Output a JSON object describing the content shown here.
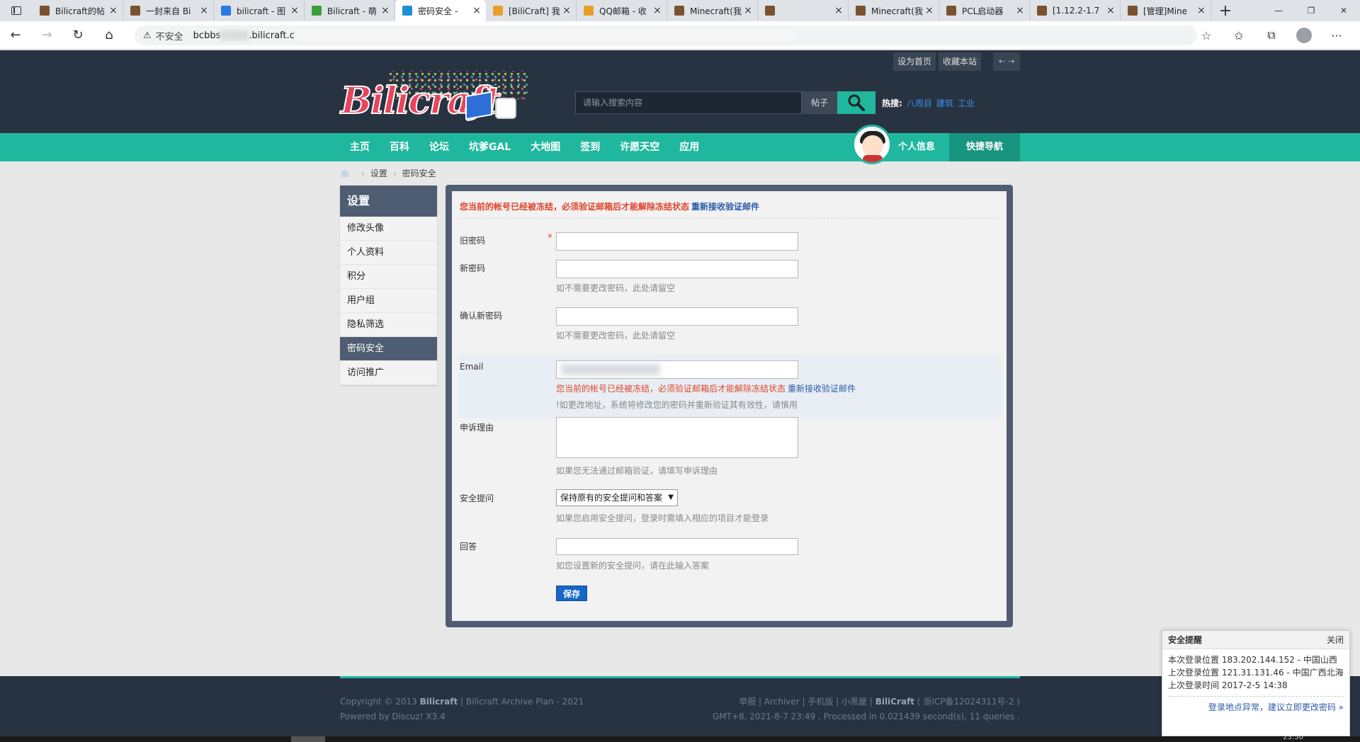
{
  "browser": {
    "tabs": [
      {
        "title": "Bilicraft的帖",
        "color": "#7a5230",
        "active": false
      },
      {
        "title": "一封来自 Bi",
        "color": "#7a5230",
        "active": false
      },
      {
        "title": "bilicraft - 图",
        "color": "#2a7ae2",
        "active": false
      },
      {
        "title": "Bilicraft - 萌",
        "color": "#3aa03a",
        "active": false
      },
      {
        "title": "密码安全 -",
        "color": "#1e8fd6",
        "active": true
      },
      {
        "title": "[BiliCraft] 我",
        "color": "#e6a02a",
        "active": false
      },
      {
        "title": "QQ邮箱 - 收",
        "color": "#e6a02a",
        "active": false
      },
      {
        "title": "Minecraft(我",
        "color": "#7a5230",
        "active": false
      },
      {
        "title": "",
        "color": "#7a5230",
        "active": false
      },
      {
        "title": "Minecraft(我",
        "color": "#7a5230",
        "active": false
      },
      {
        "title": "PCL启动器",
        "color": "#7a5230",
        "active": false
      },
      {
        "title": "[1.12.2-1.7",
        "color": "#7a5230",
        "active": false
      },
      {
        "title": "[管理]Mine",
        "color": "#7a5230",
        "active": false
      }
    ],
    "new_tab": "+",
    "win": {
      "min": "—",
      "max": "❐",
      "close": "✕"
    },
    "nav": {
      "back": "←",
      "forward": "→",
      "reload": "↻",
      "home": "⌂"
    },
    "url": {
      "warn_icon": "⚠",
      "insecure": "不安全",
      "text": "bcbbs",
      "text2": ".bilicraft.c"
    },
    "addr_icons": {
      "fav": "☆",
      "favorites": "✩",
      "collections": "⧉",
      "more": "···"
    }
  },
  "site": {
    "top_links": [
      "设为首页",
      "收藏本站"
    ],
    "top_arrows": "⇠ ⇢",
    "logo": "Bilicraft",
    "search": {
      "placeholder": "请输入搜索内容",
      "type": "帖子"
    },
    "hot": {
      "label": "热搜:",
      "items": [
        "八周目",
        "建筑",
        "工业"
      ]
    },
    "nav": [
      "主页",
      "百科",
      "论坛",
      "坑爹GAL",
      "大地图",
      "签到",
      "许愿天空",
      "应用"
    ],
    "me": "个人信息",
    "quick_nav": "快捷导航"
  },
  "breadcrumb": {
    "items": [
      "设置",
      "密码安全"
    ],
    "sep": "›"
  },
  "sidebar": {
    "title": "设置",
    "items": [
      "修改头像",
      "个人资料",
      "积分",
      "用户组",
      "隐私筛选",
      "密码安全",
      "访问推广"
    ],
    "active_index": 5
  },
  "form": {
    "notice": "您当前的帐号已经被冻结，必须验证邮箱后才能解除冻结状态",
    "notice_link": "重新接收验证邮件",
    "old_pw": "旧密码",
    "required": "*",
    "new_pw": "新密码",
    "new_pw_hint": "如不需要更改密码，此处请留空",
    "confirm_pw": "确认新密码",
    "confirm_pw_hint": "如不需要更改密码，此处请留空",
    "email": "Email",
    "email_warn": "您当前的帐号已经被冻结，必须验证邮箱后才能解除冻结状态",
    "email_warn_link": "重新接收验证邮件",
    "email_hint": "!如更改地址，系统将修改您的密码并重新验证其有效性，请慎用",
    "appeal": "申诉理由",
    "appeal_hint": "如果您无法通过邮箱验证，请填写申诉理由",
    "question": "安全提问",
    "question_value": "保持原有的安全提问和答案",
    "question_hint": "如果您启用安全提问，登录时需填入相应的项目才能登录",
    "answer": "回答",
    "answer_hint": "如您设置新的安全提问，请在此输入答案",
    "save": "保存"
  },
  "footer": {
    "copyright_pre": "Copyright © 2013 ",
    "copyright_name": "Bilicraft",
    "copyright_post": " | Bilicraft Archive Plan - 2021",
    "powered": "Powered by Discuz! X3.4",
    "links": "举报 | Archiver | 手机版 | 小黑屋 | ",
    "site_name": "BiliCraft",
    "icp": " ( 浙ICP备12024311号-2 )",
    "stats": "GMT+8, 2021-8-7 23:49 , Processed in 0.021439 second(s), 11 queries ."
  },
  "security": {
    "title": "安全提醒",
    "close": "关闭",
    "line1": "本次登录位置 183.202.144.152 - 中国山西",
    "line2": "上次登录位置 121.31.131.46 - 中国广西北海",
    "line3": "上次登录时间 2017-2-5 14:38",
    "link": "登录地点异常，建议立即更改密码 »"
  },
  "taskbar": {
    "clock": "23:50"
  }
}
